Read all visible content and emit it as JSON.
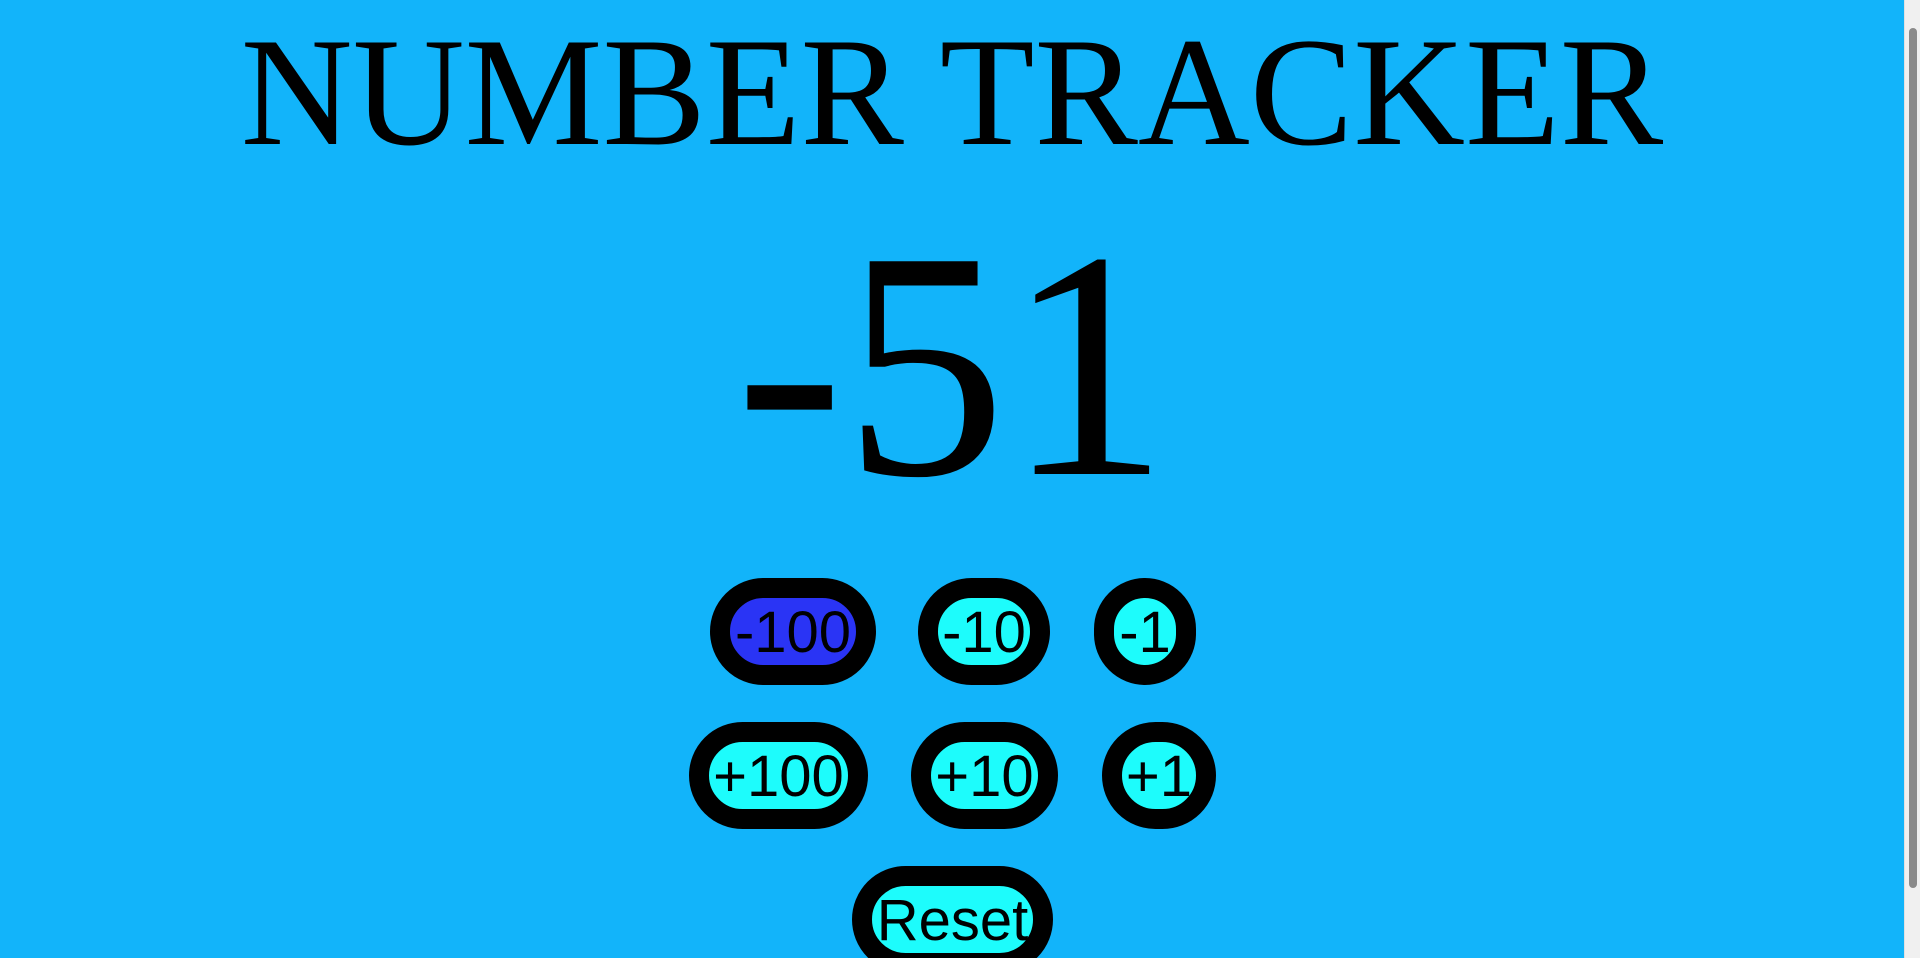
{
  "app": {
    "title": "NUMBER TRACKER",
    "current_value": "-51"
  },
  "buttons": {
    "minus_100": "-100",
    "minus_10": "-10",
    "minus_1": "-1",
    "plus_100": "+100",
    "plus_10": "+10",
    "plus_1": "+1",
    "reset": "Reset"
  },
  "colors": {
    "background": "#12b4fa",
    "button_fill": "#1dfcfc",
    "button_active_fill": "#2a34f5",
    "button_border": "#000000"
  }
}
